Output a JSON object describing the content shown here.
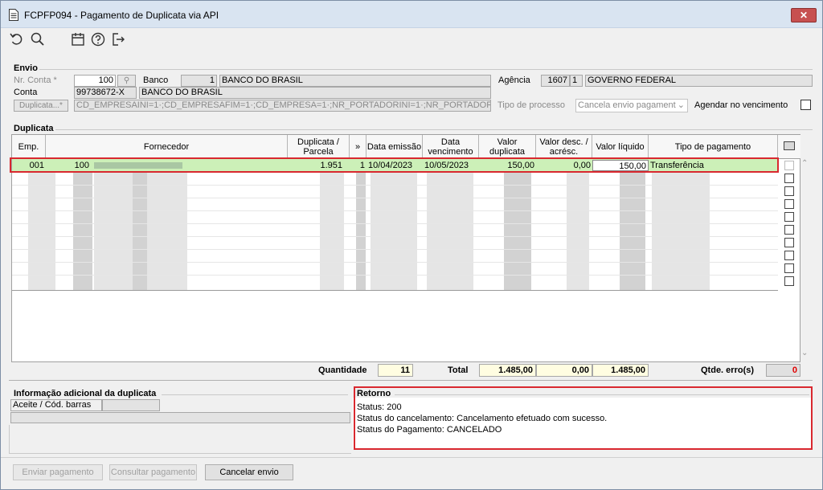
{
  "window": {
    "title": "FCPFP094 - Pagamento de Duplicata via API"
  },
  "toolbar": {
    "icons": [
      "undo-icon",
      "search-icon",
      "calendar-icon",
      "help-icon",
      "exit-icon"
    ]
  },
  "envio": {
    "group_label": "Envio",
    "nr_conta_label": "Nr. Conta *",
    "nr_conta_value": "100",
    "banco_label": "Banco",
    "banco_code": "1",
    "banco_name": "BANCO DO BRASIL",
    "agencia_label": "Agência",
    "agencia_code": "1607",
    "agencia_dv": "1",
    "agencia_name": "GOVERNO FEDERAL",
    "conta_label": "Conta",
    "conta_value": "99738672-X",
    "conta_banco_name": "BANCO DO BRASIL",
    "duplicata_button": "Duplicata...*",
    "duplicata_filter": "CD_EMPRESAINI=1·;CD_EMPRESAFIM=1·;CD_EMPRESA=1·;NR_PORTADORINI=1·;NR_PORTADORFIM=1·;NR",
    "tipo_processo_label": "Tipo de processo",
    "tipo_processo_value": "Cancela envio pagament",
    "agendar_label": "Agendar no vencimento"
  },
  "duplicata": {
    "group_label": "Duplicata",
    "columns": [
      "Emp.",
      "Fornecedor",
      "Duplicata / Parcela",
      "»",
      "Data emissão",
      "Data vencimento",
      "Valor duplicata",
      "Valor desc. / acrésc.",
      "Valor líquido",
      "Tipo de pagamento"
    ],
    "row": {
      "emp": "001",
      "fornecedor_cod": "100",
      "duplicata": "1.951",
      "parcela": "1",
      "data_emissao": "10/04/2023",
      "data_vencimento": "10/05/2023",
      "valor_duplicata": "150,00",
      "valor_desc": "0,00",
      "valor_liquido": "150,00",
      "tipo_pagamento": "Transferência"
    }
  },
  "totals": {
    "quantidade_label": "Quantidade",
    "quantidade_value": "11",
    "total_label": "Total",
    "total_duplicata": "1.485,00",
    "total_desc": "0,00",
    "total_liquido": "1.485,00",
    "erros_label": "Qtde. erro(s)",
    "erros_value": "0"
  },
  "info": {
    "group_label": "Informação adicional da duplicata",
    "aceite_label": "Aceite / Cód. barras"
  },
  "retorno": {
    "group_label": "Retorno",
    "lines": [
      "Status: 200",
      "Status do cancelamento: Cancelamento efetuado com sucesso.",
      "Status do Pagamento: CANCELADO"
    ]
  },
  "buttons": {
    "enviar": "Enviar pagamento",
    "consultar": "Consultar pagamento",
    "cancelar": "Cancelar envio"
  },
  "colors": {
    "selected_row": "#ccf0b8",
    "highlight": "#d9282f",
    "error_value": "#e00000"
  }
}
